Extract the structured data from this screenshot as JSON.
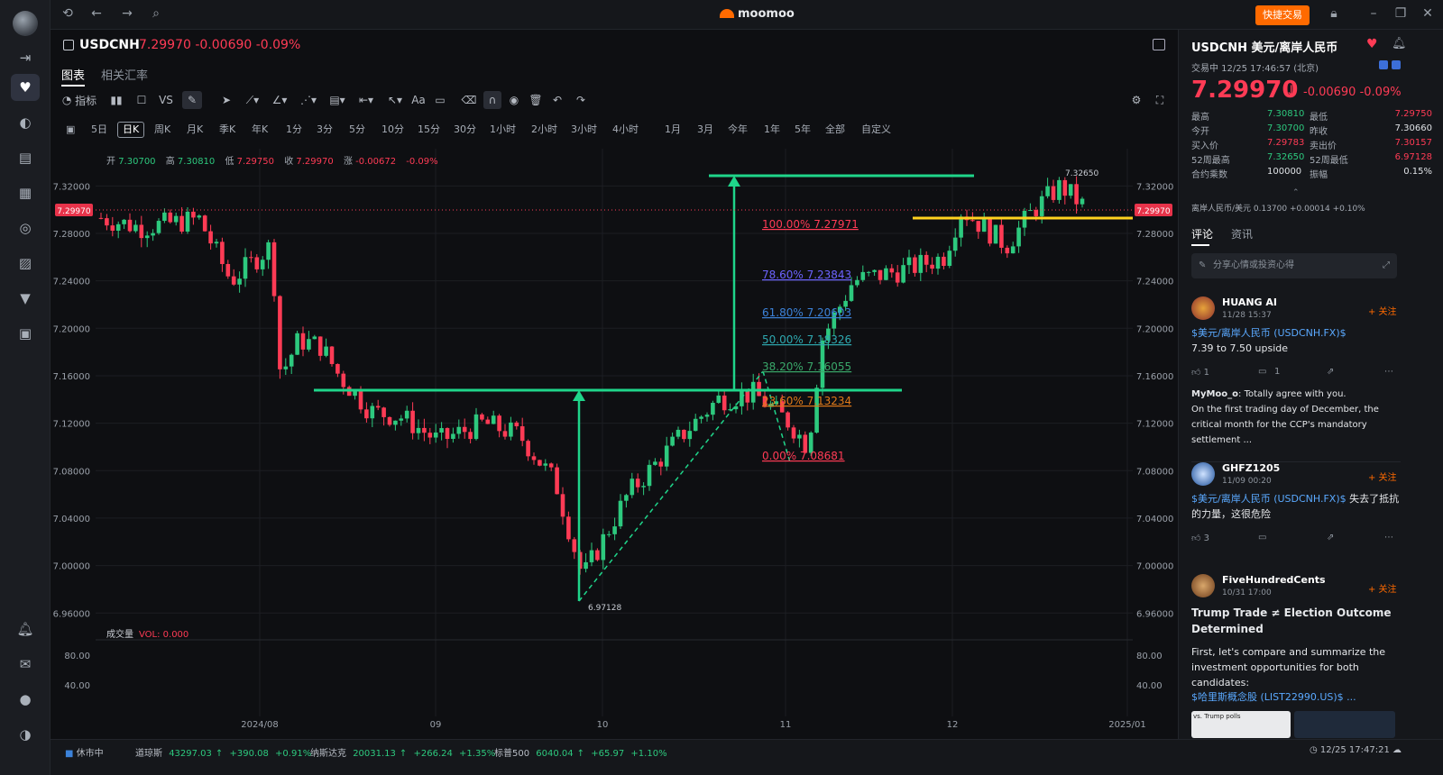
{
  "app": {
    "logo": "moomoo",
    "quick_trade": "快捷交易"
  },
  "symbol": {
    "code": "USDCNH",
    "price_line": "7.29970 -0.00690 -0.09%",
    "tabs": [
      "图表",
      "相关汇率"
    ]
  },
  "toolbar": {
    "indicator_label": "指标",
    "vs_label": "VS"
  },
  "periods": [
    "5日",
    "日K",
    "周K",
    "月K",
    "季K",
    "年K",
    "1分",
    "3分",
    "5分",
    "10分",
    "15分",
    "30分",
    "1小时",
    "2小时",
    "3小时",
    "4小时",
    "1月",
    "3月",
    "今年",
    "1年",
    "5年",
    "全部",
    "自定义"
  ],
  "active_period": "日K",
  "ohlc": {
    "open_label": "开",
    "open": "7.30700",
    "high_label": "高",
    "high": "7.30810",
    "low_label": "低",
    "low": "7.29750",
    "close_label": "收",
    "close": "7.29970",
    "change_label": "涨",
    "change": "-0.00672",
    "change_pct": "-0.09%"
  },
  "volume": {
    "label": "成交量",
    "value": "VOL: 0.000"
  },
  "chart_data": {
    "type": "candlestick",
    "y_ticks": [
      "7.32000",
      "7.28000",
      "7.24000",
      "7.20000",
      "7.16000",
      "7.12000",
      "7.08000",
      "7.04000",
      "7.00000",
      "6.96000"
    ],
    "vol_ticks": [
      "80.00",
      "40.00"
    ],
    "x_ticks": [
      "2024/08",
      "09",
      "10",
      "11",
      "12",
      "2025/01"
    ],
    "last_price": "7.29970",
    "max_label": "7.32650",
    "min_label": "6.97128",
    "fib_levels": [
      {
        "label": "100.00%",
        "value": "7.27971",
        "color": "#ff3b55"
      },
      {
        "label": "78.60%",
        "value": "7.23843",
        "color": "#6c63ff"
      },
      {
        "label": "61.80%",
        "value": "7.20603",
        "color": "#3c82d9"
      },
      {
        "label": "50.00%",
        "value": "7.18326",
        "color": "#2ea9b0"
      },
      {
        "label": "38.20%",
        "value": "7.16055",
        "color": "#3aa86a"
      },
      {
        "label": "23.60%",
        "value": "7.13234",
        "color": "#e07a1a"
      },
      {
        "label": "0.00%",
        "value": "7.08681",
        "color": "#ff3b55"
      }
    ],
    "colors": {
      "up": "#2dc97e",
      "down": "#ff3b55",
      "annotation": "#1fd58a",
      "resistance": "#ffd21f"
    }
  },
  "status": {
    "market": "休市中",
    "indices": [
      {
        "name": "道琼斯",
        "value": "43297.03",
        "chg": "+390.08",
        "pct": "+0.91%"
      },
      {
        "name": "纳斯达克",
        "value": "20031.13",
        "chg": "+266.24",
        "pct": "+1.35%"
      },
      {
        "name": "标普500",
        "value": "6040.04",
        "chg": "+65.97",
        "pct": "+1.10%"
      }
    ],
    "clock": "12/25 17:47:21"
  },
  "quote": {
    "title": "USDCNH  美元/离岸人民币",
    "status": "交易中 12/25 17:46:57 (北京)",
    "price": "7.29970",
    "change": "-0.00690  -0.09%",
    "rows": [
      {
        "l1": "最高",
        "v1": "7.30810",
        "c1": "grn",
        "l2": "最低",
        "v2": "7.29750",
        "c2": "red"
      },
      {
        "l1": "今开",
        "v1": "7.30700",
        "c1": "grn",
        "l2": "昨收",
        "v2": "7.30660",
        "c2": "wht"
      },
      {
        "l1": "买入价",
        "v1": "7.29783",
        "c1": "red",
        "l2": "卖出价",
        "v2": "7.30157",
        "c2": "red"
      },
      {
        "l1": "52周最高",
        "v1": "7.32650",
        "c1": "grn",
        "l2": "52周最低",
        "v2": "6.97128",
        "c2": "red"
      },
      {
        "l1": "合约乘数",
        "v1": "100000",
        "c1": "wht",
        "l2": "振幅",
        "v2": "0.15%",
        "c2": "wht"
      }
    ],
    "related": "离岸人民币/美元  0.13700  +0.00014  +0.10%"
  },
  "feed": {
    "tabs": [
      "评论",
      "资讯"
    ],
    "share_placeholder": "分享心情或投资心得",
    "follow_label": "+ 关注",
    "posts": [
      {
        "name": "HUANG AI",
        "time": "11/28 15:37",
        "link": "$美元/离岸人民币 (USDCNH.FX)$",
        "text": "7.39 to 7.50 upside",
        "likes": "1",
        "comments": "1",
        "reply_user": "MyMoo_o",
        "reply_text": ": Totally agree with you.",
        "reply_more": "On the first trading day of December, the critical month for the CCP's mandatory settlement ..."
      },
      {
        "name": "GHFZ1205",
        "time": "11/09 00:20",
        "link": "$美元/离岸人民币 (USDCNH.FX)$",
        "text": " 失去了抵抗的力量，这很危险",
        "likes": "3"
      },
      {
        "name": "FiveHundredCents",
        "time": "10/31 17:00",
        "headline": "Trump Trade ≠ Election Outcome Determined",
        "text": "First, let's compare and summarize the investment opportunities for both candidates:",
        "link": "$哈里斯概念股 (LIST22990.US)$ ...",
        "thumb_text": "vs. Trump polls"
      }
    ]
  }
}
